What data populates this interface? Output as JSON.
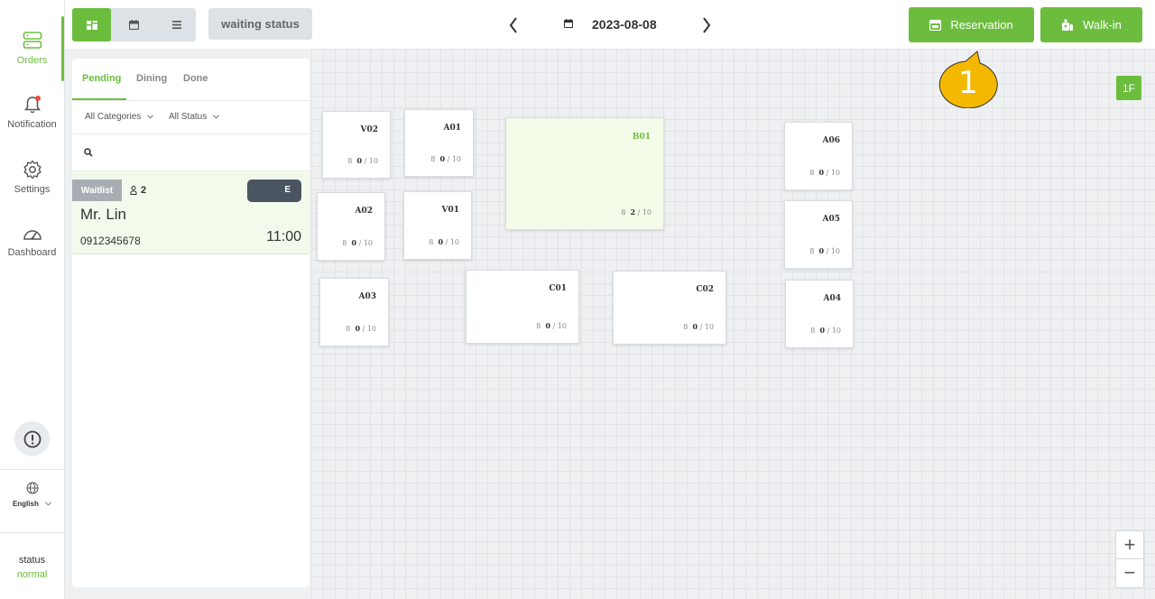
{
  "sidebar": {
    "items": [
      {
        "label": "Orders",
        "icon": "orders-icon"
      },
      {
        "label": "Notification",
        "icon": "bell-icon"
      },
      {
        "label": "Settings",
        "icon": "gear-icon"
      },
      {
        "label": "Dashboard",
        "icon": "dashboard-icon"
      }
    ],
    "language": "English",
    "status_label": "status",
    "status_value": "normal"
  },
  "topbar": {
    "waiting_status": "waiting status",
    "date": "2023-08-08",
    "reservation_label": "Reservation",
    "walkin_label": "Walk-in"
  },
  "panel": {
    "tabs": [
      "Pending",
      "Dining",
      "Done"
    ],
    "filters": [
      "All Categories",
      "All Status"
    ],
    "order": {
      "badge": "Waitlist",
      "guests": "2",
      "edit_label": "E",
      "name": "Mr. Lin",
      "phone": "0912345678",
      "time": "11:00"
    }
  },
  "floor": {
    "level": "1F",
    "tables": [
      {
        "name": "V02",
        "current": "0",
        "capacity": "/ 10"
      },
      {
        "name": "A01",
        "current": "0",
        "capacity": "/ 10"
      },
      {
        "name": "B01",
        "current": "2",
        "capacity": "/ 10"
      },
      {
        "name": "A06",
        "current": "0",
        "capacity": "/ 10"
      },
      {
        "name": "A02",
        "current": "0",
        "capacity": "/ 10"
      },
      {
        "name": "V01",
        "current": "0",
        "capacity": "/ 10"
      },
      {
        "name": "A05",
        "current": "0",
        "capacity": "/ 10"
      },
      {
        "name": "A03",
        "current": "0",
        "capacity": "/ 10"
      },
      {
        "name": "C01",
        "current": "0",
        "capacity": "/ 10"
      },
      {
        "name": "C02",
        "current": "0",
        "capacity": "/ 10"
      },
      {
        "name": "A04",
        "current": "0",
        "capacity": "/ 10"
      }
    ],
    "zoom_in": "+",
    "zoom_out": "−"
  },
  "callout": {
    "number": "1"
  },
  "colors": {
    "accent": "#6cbd3e",
    "callout": "#f5b800",
    "edit_button": "#4a5561"
  }
}
